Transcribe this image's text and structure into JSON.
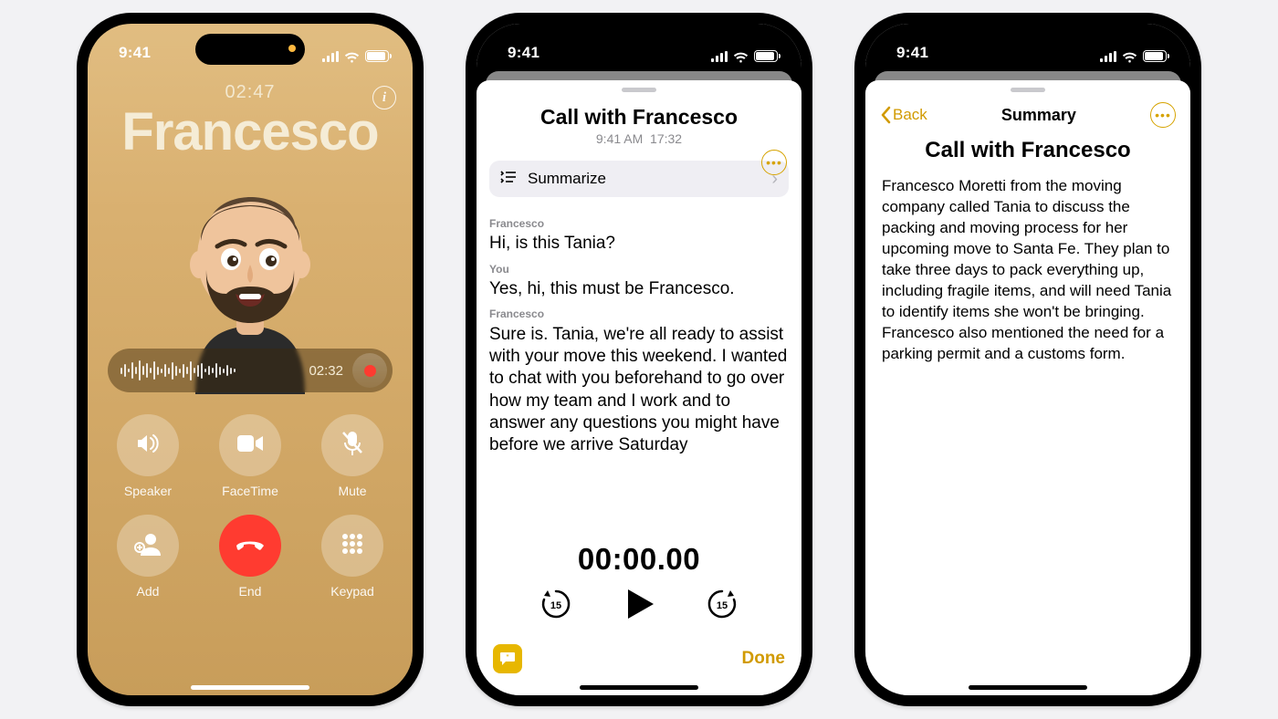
{
  "status": {
    "time": "9:41"
  },
  "call": {
    "duration": "02:47",
    "name": "Francesco",
    "rec_time": "02:32",
    "buttons": {
      "speaker": "Speaker",
      "facetime": "FaceTime",
      "mute": "Mute",
      "add": "Add",
      "end": "End",
      "keypad": "Keypad"
    }
  },
  "transcript": {
    "title": "Call with Francesco",
    "meta_time": "9:41 AM",
    "meta_dur": "17:32",
    "summarize_label": "Summarize",
    "lines": [
      {
        "who": "Francesco",
        "text": "Hi, is this Tania?"
      },
      {
        "who": "You",
        "text": "Yes, hi, this must be Francesco."
      },
      {
        "who": "Francesco",
        "text": "Sure is. Tania, we're all ready to assist with your move this weekend. I wanted to chat with you beforehand to go over how my team and I work and to answer any questions you might have before we arrive Saturday"
      }
    ],
    "player_time": "00:00.00",
    "skip_sec": "15",
    "done": "Done"
  },
  "summary": {
    "back": "Back",
    "nav_title": "Summary",
    "title": "Call with Francesco",
    "body": "Francesco Moretti from the moving company called Tania to discuss the packing and moving process for her upcoming move to Santa Fe. They plan to take three days to pack everything up, including fragile items, and will need Tania to identify items she won't be bringing. Francesco also mentioned the need for a parking permit and a customs form."
  }
}
